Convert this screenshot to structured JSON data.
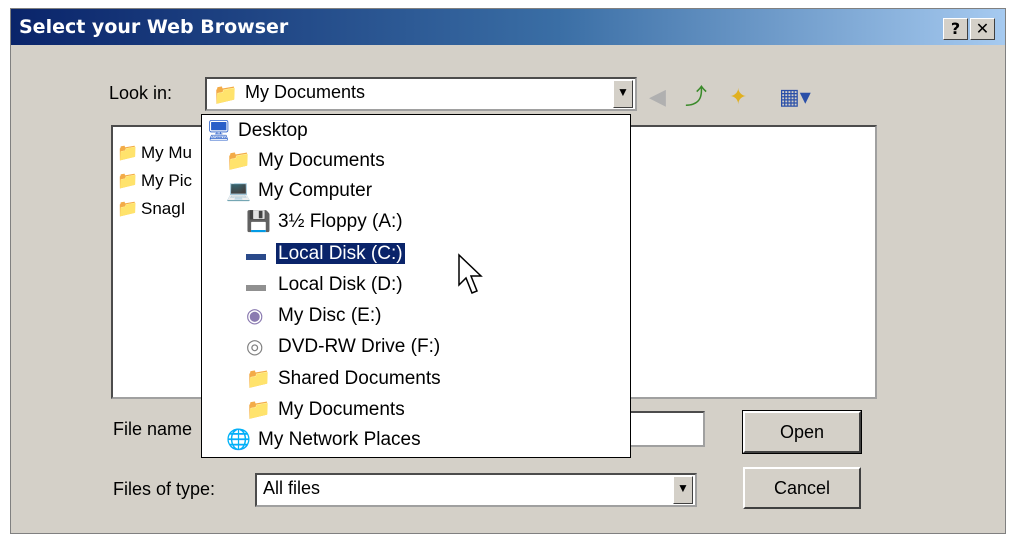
{
  "dialog": {
    "title": "Select your Web Browser",
    "help_label": "?",
    "close_label": "✕"
  },
  "look_in": {
    "label": "Look in:",
    "value": "My Documents",
    "icon": "my-documents-icon"
  },
  "toolbar": {
    "back_icon": "back-icon",
    "up_icon": "up-folder-icon",
    "new_folder_icon": "new-folder-icon",
    "views_icon": "views-menu-icon"
  },
  "file_list": {
    "items": [
      {
        "label": "My Mu",
        "icon": "my-music-folder-icon"
      },
      {
        "label": "My Pic",
        "icon": "my-pictures-folder-icon"
      },
      {
        "label": "SnagI",
        "icon": "folder-icon"
      }
    ]
  },
  "dropdown": {
    "items": [
      {
        "label": "Desktop",
        "icon": "desktop-icon",
        "indent": 0,
        "selected": false
      },
      {
        "label": "My Documents",
        "icon": "my-documents-icon",
        "indent": 1,
        "selected": false
      },
      {
        "label": "My Computer",
        "icon": "my-computer-icon",
        "indent": 1,
        "selected": false
      },
      {
        "label": "3½ Floppy (A:)",
        "icon": "floppy-drive-icon",
        "indent": 2,
        "selected": false
      },
      {
        "label": "Local Disk (C:)",
        "icon": "hard-disk-icon",
        "indent": 2,
        "selected": true
      },
      {
        "label": "Local Disk (D:)",
        "icon": "hard-disk-icon",
        "indent": 2,
        "selected": false
      },
      {
        "label": "My Disc (E:)",
        "icon": "cd-drive-icon",
        "indent": 2,
        "selected": false
      },
      {
        "label": "DVD-RW Drive (F:)",
        "icon": "dvd-drive-icon",
        "indent": 2,
        "selected": false
      },
      {
        "label": "Shared Documents",
        "icon": "folder-icon",
        "indent": 2,
        "selected": false
      },
      {
        "label": "My Documents",
        "icon": "folder-icon",
        "indent": 2,
        "selected": false
      },
      {
        "label": "My Network Places",
        "icon": "network-places-icon",
        "indent": 1,
        "selected": false
      }
    ]
  },
  "file_name": {
    "label": "File name",
    "value": ""
  },
  "files_of_type": {
    "label": "Files of type:",
    "value": "All files"
  },
  "buttons": {
    "open": "Open",
    "cancel": "Cancel"
  }
}
